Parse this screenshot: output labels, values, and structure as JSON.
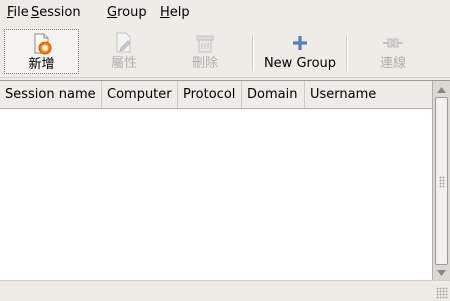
{
  "menubar": {
    "items": [
      {
        "mnemonic": "F",
        "rest": "ile"
      },
      {
        "mnemonic": "S",
        "rest": "ession"
      },
      {
        "mnemonic": "G",
        "rest": "roup"
      },
      {
        "mnemonic": "H",
        "rest": "elp"
      }
    ]
  },
  "toolbar": {
    "new_label": "新增",
    "properties_label": "屬性",
    "delete_label": "刪除",
    "new_group_label": "New Group",
    "connect_label": "連線"
  },
  "table": {
    "columns": [
      "Session name",
      "Computer",
      "Protocol",
      "Domain",
      "Username"
    ],
    "rows": []
  },
  "colors": {
    "accent_orange": "#f57900",
    "new_group_blue": "#3465a4",
    "disabled_text": "#b3afab"
  }
}
